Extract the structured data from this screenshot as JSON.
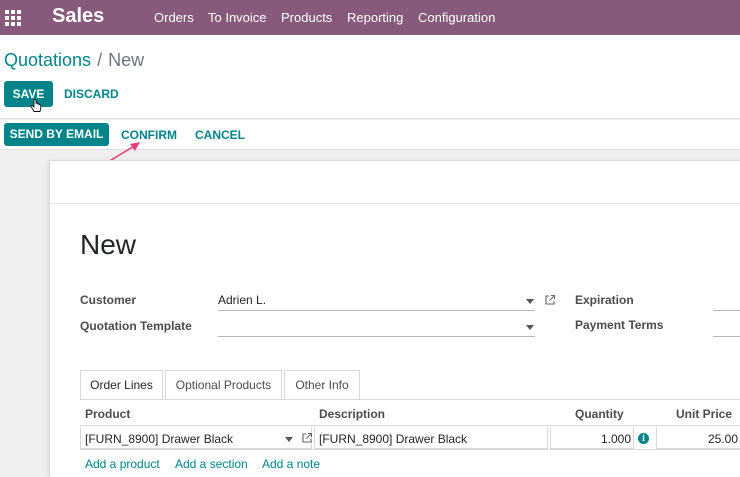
{
  "navbar": {
    "app_name": "Sales",
    "menu": [
      "Orders",
      "To Invoice",
      "Products",
      "Reporting",
      "Configuration"
    ]
  },
  "breadcrumb": {
    "parent": "Quotations",
    "separator": "/",
    "current": "New"
  },
  "control_buttons": {
    "save": "SAVE",
    "discard": "DISCARD"
  },
  "status_buttons": {
    "send_by_email": "SEND BY EMAIL",
    "confirm": "CONFIRM",
    "cancel": "CANCEL"
  },
  "form": {
    "title": "New",
    "customer": {
      "label": "Customer",
      "value": "Adrien L."
    },
    "quotation_template": {
      "label": "Quotation Template",
      "value": ""
    },
    "expiration": {
      "label": "Expiration",
      "value": ""
    },
    "payment_terms": {
      "label": "Payment Terms",
      "value": ""
    }
  },
  "tabs": [
    "Order Lines",
    "Optional Products",
    "Other Info"
  ],
  "order_lines": {
    "columns": [
      "Product",
      "Description",
      "Quantity",
      "Unit Price"
    ],
    "rows": [
      {
        "product": "[FURN_8900] Drawer Black",
        "description": "[FURN_8900] Drawer Black",
        "quantity": "1.000",
        "unit_price": "25.00"
      }
    ],
    "actions": [
      "Add a product",
      "Add a section",
      "Add a note"
    ]
  },
  "colors": {
    "brand": "#875a7b",
    "accent": "#00848a",
    "annotation": "#e8417a"
  },
  "icons": {
    "apps": "apps-grid-icon",
    "external": "external-link-icon",
    "info": "info-icon",
    "caret": "caret-down-icon"
  }
}
